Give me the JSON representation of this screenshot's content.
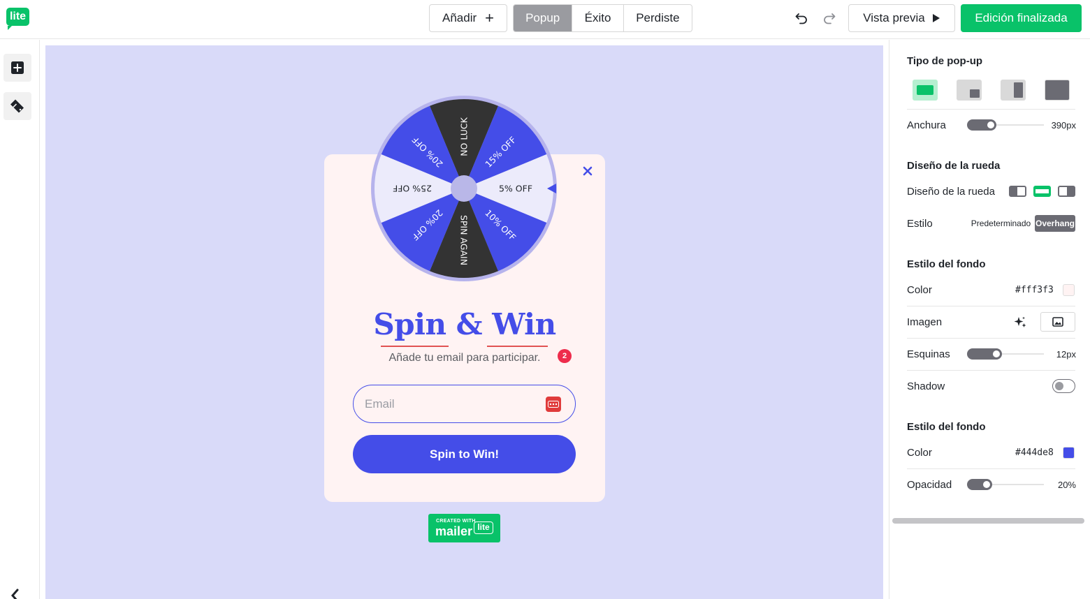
{
  "app": {
    "logo": "lite"
  },
  "toolbar": {
    "add_label": "Añadir",
    "views": [
      {
        "label": "Popup",
        "active": true
      },
      {
        "label": "Éxito",
        "active": false
      },
      {
        "label": "Perdiste",
        "active": false
      }
    ],
    "preview_label": "Vista previa",
    "done_label": "Edición finalizada"
  },
  "popup": {
    "wheel_segments": [
      "NO LUCK",
      "15% OFF",
      "5% OFF",
      "10% OFF",
      "SPIN AGAIN",
      "20% OFF",
      "25% OFF",
      "20% OFF"
    ],
    "headline": "Spin & Win",
    "subtitle": "Añade tu email para participar.",
    "notification_count": "2",
    "email_placeholder": "Email",
    "button_label": "Spin to Win!",
    "branding": {
      "small": "CREATED WITH",
      "big": "mailer",
      "badge": "lite"
    }
  },
  "panel": {
    "type_title": "Tipo de pop-up",
    "width_label": "Anchura",
    "width_value": "390px",
    "width_level": 0.25,
    "wheel_title": "Diseño de la rueda",
    "wheel_label": "Diseño de la rueda",
    "style_label": "Estilo",
    "style_options": [
      "Predeterminado",
      "Overhang"
    ],
    "bg1_title": "Estilo del fondo",
    "bg1_color_label": "Color",
    "bg1_color_value": "#fff3f3",
    "image_label": "Imagen",
    "corners_label": "Esquinas",
    "corners_value": "12px",
    "corners_level": 0.33,
    "shadow_label": "Shadow",
    "bg2_title": "Estilo del fondo",
    "bg2_color_label": "Color",
    "bg2_color_value": "#444de8",
    "opacity_label": "Opacidad",
    "opacity_value": "20%",
    "opacity_level": 0.2
  },
  "colors": {
    "brand_green": "#09c269",
    "accent_blue": "#444de8",
    "canvas_bg": "#d9daf9",
    "popup_bg": "#fff3f3",
    "wheel_dark": "#333333",
    "wheel_light": "#ecebfb"
  }
}
